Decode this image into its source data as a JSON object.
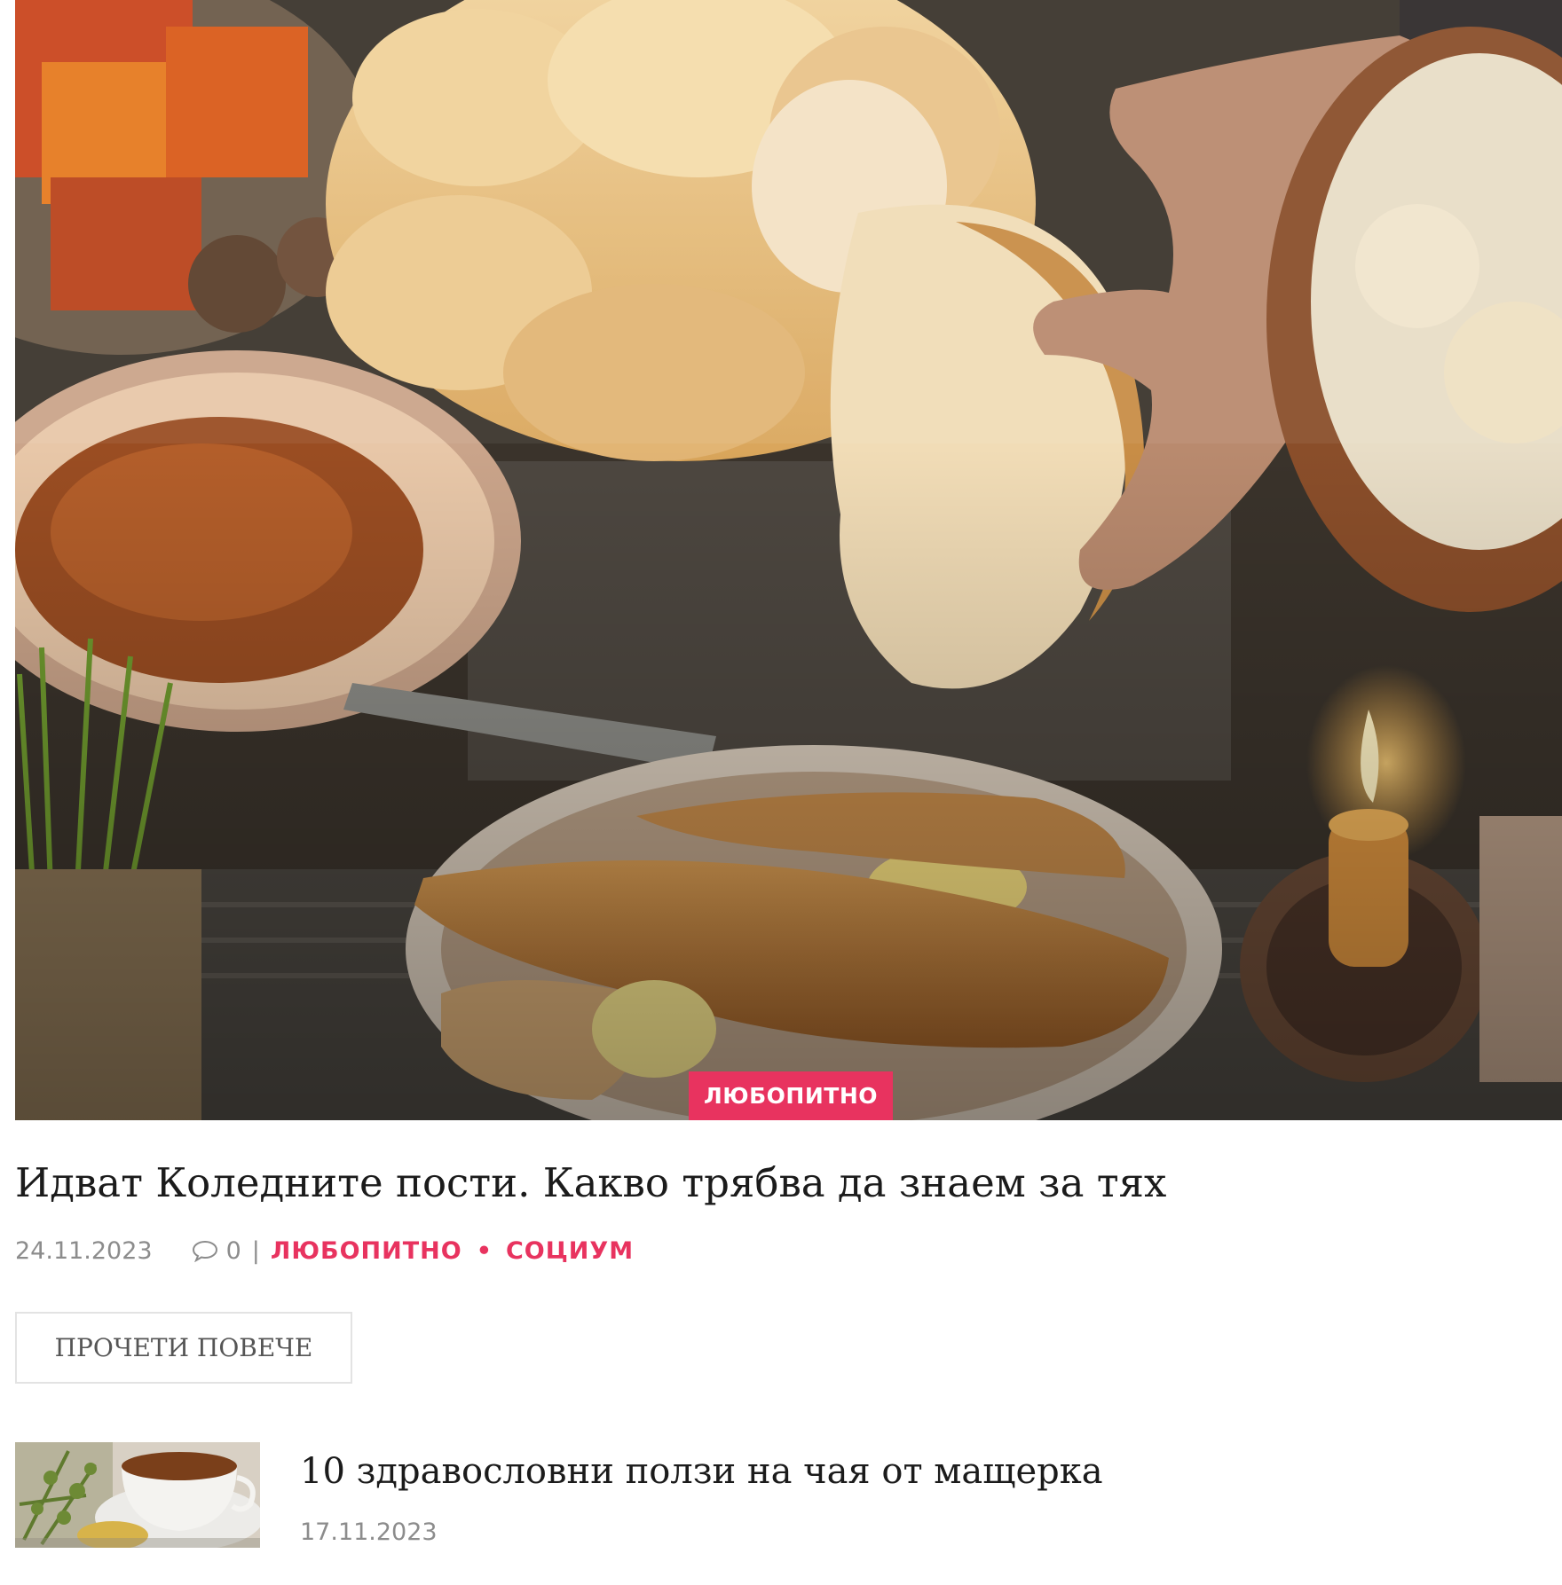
{
  "featured_post": {
    "image_alt": "Коледна трапеза с питка, риба и свещ",
    "category_badge": "ЛЮБОПИТНО",
    "title": "Идват Коледните пости. Какво трябва да знаем за тях",
    "date": "24.11.2023",
    "comment_count": "0",
    "separator": "|",
    "categories": [
      "ЛЮБОПИТНО",
      "СОЦИУМ"
    ],
    "category_dot": "•",
    "read_more_label": "ПРОЧЕТИ ПОВЕЧЕ"
  },
  "related_post": {
    "title": "10 здравословни ползи на чая от мащерка",
    "date": "17.11.2023"
  },
  "colors": {
    "accent": "#e8335f",
    "text": "#1b1b1b",
    "muted": "#8c8c8c",
    "border": "#e3e3e3"
  },
  "icons": {
    "comments": "speech-bubble-icon"
  }
}
